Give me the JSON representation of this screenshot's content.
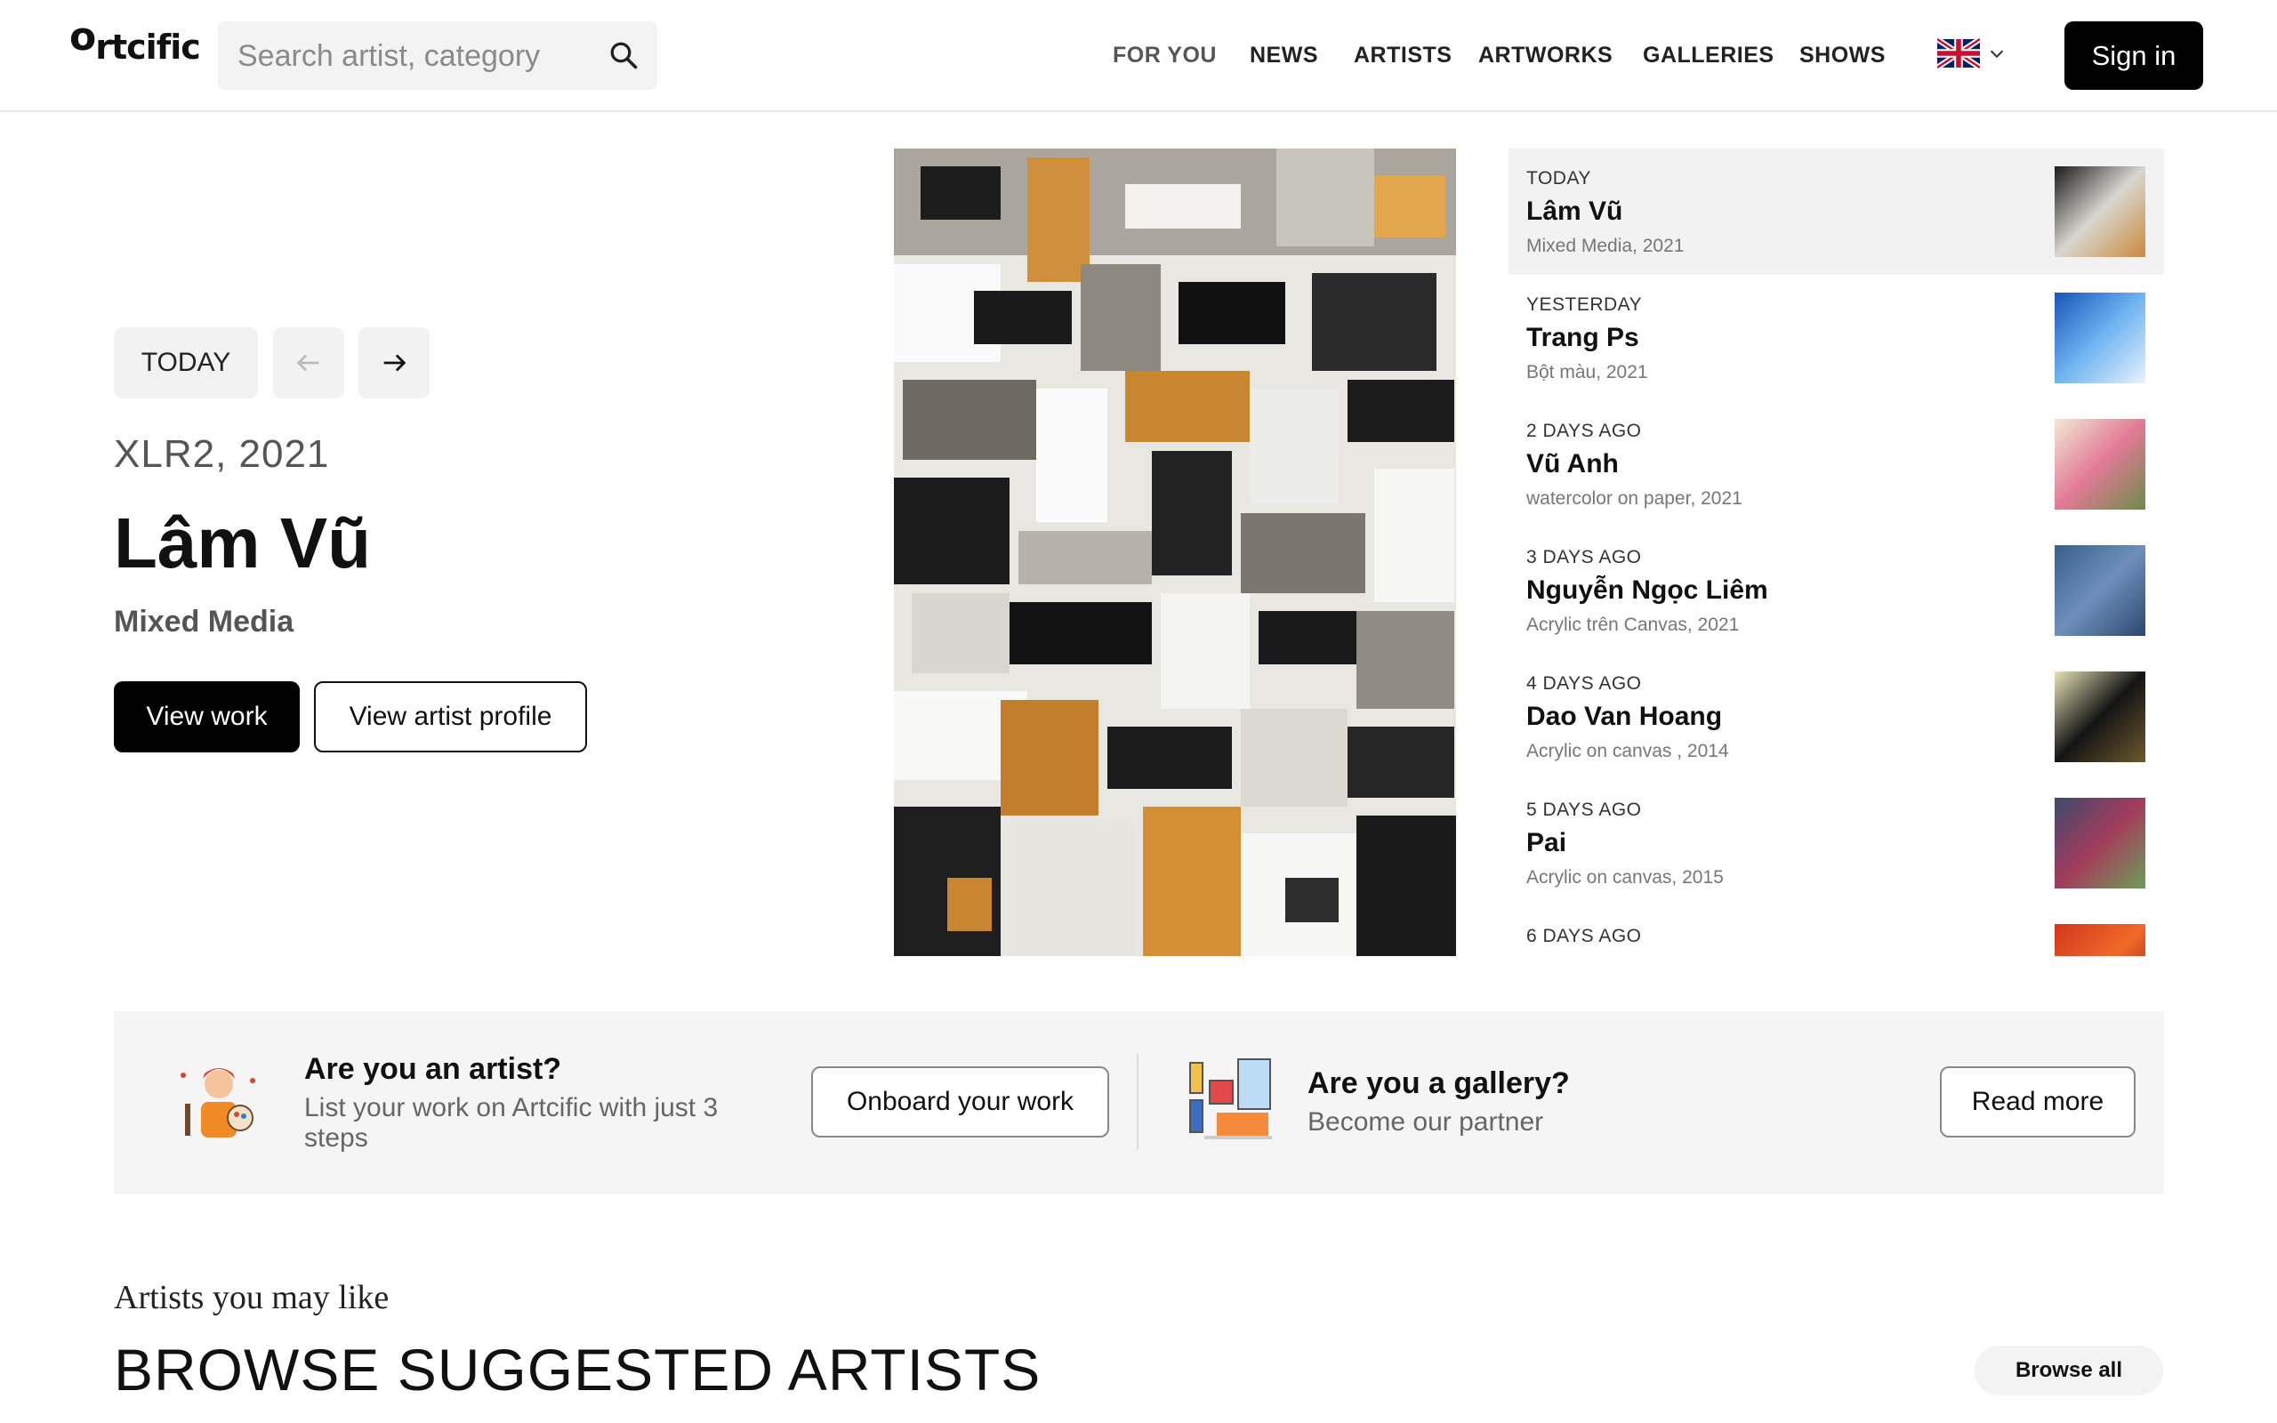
{
  "header": {
    "logo_first": "o",
    "logo_rest": "rtcific",
    "search_placeholder": "Search artist, category",
    "nav": [
      "FOR YOU",
      "NEWS",
      "ARTISTS",
      "ARTWORKS",
      "GALLERIES",
      "SHOWS"
    ],
    "language": "English",
    "signin_label": "Sign in"
  },
  "hero": {
    "today_label": "TODAY",
    "artwork_title": "XLR2, 2021",
    "artist_name": "Lâm Vũ",
    "medium": "Mixed Media",
    "view_work_label": "View work",
    "view_profile_label": "View artist profile"
  },
  "timeline": [
    {
      "when": "TODAY",
      "name": "Lâm Vũ",
      "sub": "Mixed Media, 2021",
      "colors": [
        "#1b1b1b",
        "#d9d6d0",
        "#c98a3c"
      ]
    },
    {
      "when": "YESTERDAY",
      "name": "Trang Ps",
      "sub": "Bột màu, 2021",
      "colors": [
        "#1756b8",
        "#6fb3f0",
        "#e8f3ff"
      ]
    },
    {
      "when": "2 DAYS AGO",
      "name": "Vũ Anh",
      "sub": "watercolor on paper, 2021",
      "colors": [
        "#f3e8d4",
        "#e27a96",
        "#6b8c4a"
      ]
    },
    {
      "when": "3 DAYS AGO",
      "name": "Nguyễn Ngọc Liêm",
      "sub": "Acrylic trên Canvas, 2021",
      "colors": [
        "#3a5f8e",
        "#6d8fba",
        "#2c4770"
      ]
    },
    {
      "when": "4 DAYS AGO",
      "name": "Dao Van Hoang",
      "sub": "Acrylic on canvas , 2014",
      "colors": [
        "#e8e3b8",
        "#141414",
        "#6d5a2e"
      ]
    },
    {
      "when": "5 DAYS AGO",
      "name": "Pai",
      "sub": "Acrylic on canvas, 2015",
      "colors": [
        "#3c4a6e",
        "#a33b5c",
        "#6b9e58"
      ]
    },
    {
      "when": "6 DAYS AGO",
      "name": "",
      "sub": "",
      "colors": [
        "#d2351c",
        "#f06a2a",
        "#8a1a10"
      ]
    }
  ],
  "cta": {
    "artist_title": "Are you an artist?",
    "artist_sub_line1": "List your work on Artcific with just 3",
    "artist_sub_line2": "steps",
    "artist_btn": "Onboard your work",
    "gallery_title": "Are you a gallery?",
    "gallery_sub": "Become our partner",
    "gallery_btn": "Read more"
  },
  "artists_section": {
    "kicker": "Artists you may like",
    "title": "BROWSE SUGGESTED ARTISTS",
    "browse_all": "Browse all"
  }
}
